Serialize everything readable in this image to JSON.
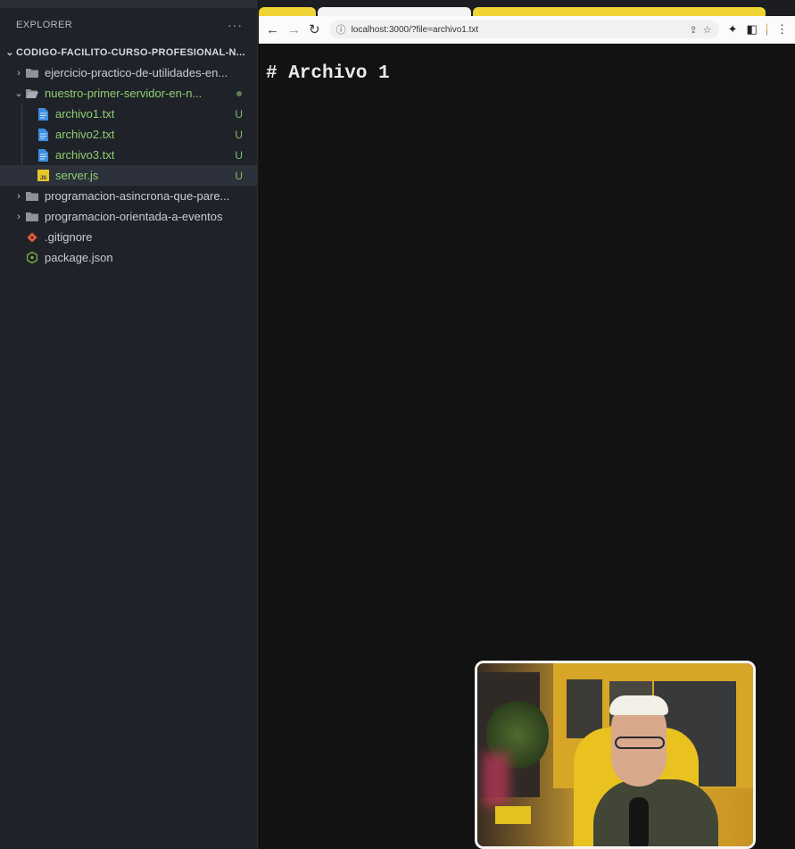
{
  "explorer": {
    "title": "EXPLORER",
    "more_label": "···",
    "project_name": "CODIGO-FACILITO-CURSO-PROFESIONAL-N...",
    "items": [
      {
        "label": "ejercicio-practico-de-utilidades-en...",
        "type": "folder",
        "expanded": false
      },
      {
        "label": "nuestro-primer-servidor-en-n...",
        "type": "folder",
        "expanded": true
      },
      {
        "label": "archivo1.txt",
        "type": "file-txt",
        "status": "U"
      },
      {
        "label": "archivo2.txt",
        "type": "file-txt",
        "status": "U"
      },
      {
        "label": "archivo3.txt",
        "type": "file-txt",
        "status": "U"
      },
      {
        "label": "server.js",
        "type": "file-js",
        "status": "U",
        "selected": true
      },
      {
        "label": "programacion-asincrona-que-pare...",
        "type": "folder",
        "expanded": false
      },
      {
        "label": "programacion-orientada-a-eventos",
        "type": "folder",
        "expanded": false
      },
      {
        "label": ".gitignore",
        "type": "file-git"
      },
      {
        "label": "package.json",
        "type": "file-json"
      }
    ]
  },
  "browser": {
    "url": "localhost:3000/?file=archivo1.txt",
    "page_heading": "# Archivo 1"
  },
  "colors": {
    "sidebar_bg": "#1f2229",
    "git_untracked": "#7fbf6a",
    "browser_page_bg": "#121212",
    "tab_yellow": "#f0d334"
  }
}
